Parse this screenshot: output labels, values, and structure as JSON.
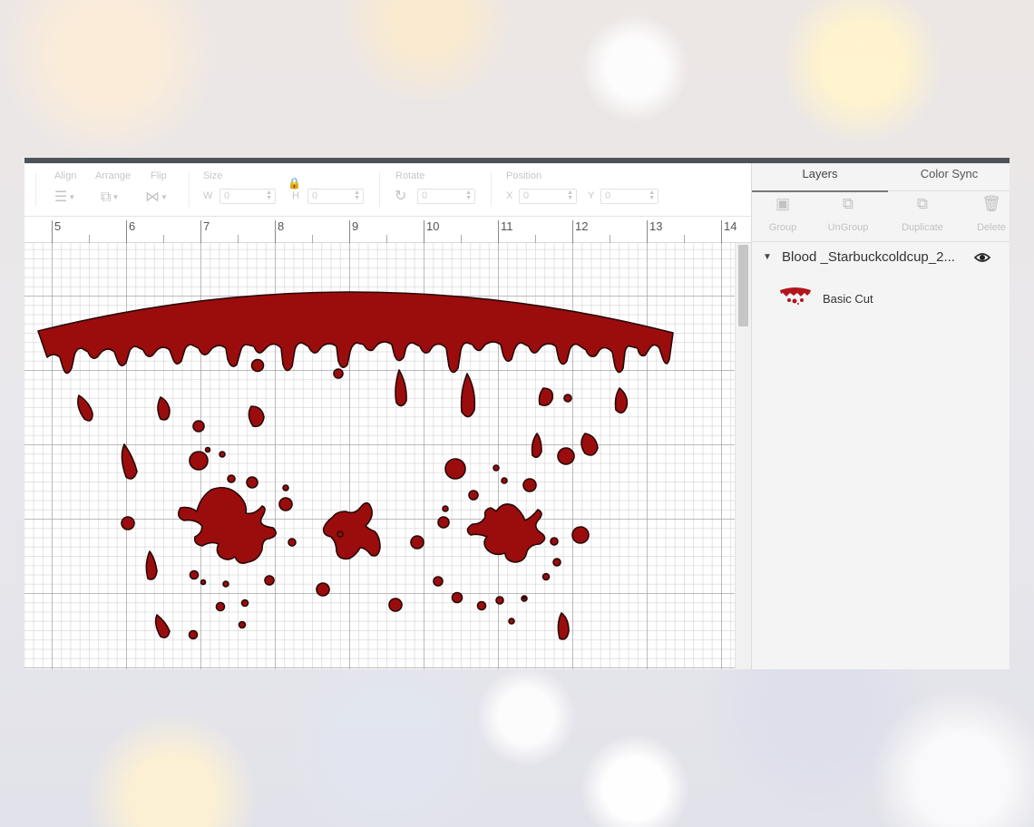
{
  "toolbar": {
    "align": {
      "label": "Align"
    },
    "arrange": {
      "label": "Arrange"
    },
    "flip": {
      "label": "Flip"
    },
    "size": {
      "label": "Size",
      "w_label": "W",
      "w_value": "0",
      "h_label": "H",
      "h_value": "0"
    },
    "rotate": {
      "label": "Rotate",
      "value": "0"
    },
    "position": {
      "label": "Position",
      "x_label": "X",
      "x_value": "0",
      "y_label": "Y",
      "y_value": "0"
    }
  },
  "ruler": {
    "ticks": [
      "5",
      "6",
      "7",
      "8",
      "9",
      "10",
      "11",
      "12",
      "13",
      "14"
    ]
  },
  "panel": {
    "tabs": [
      "Layers",
      "Color Sync"
    ],
    "actions": [
      {
        "label": "Group",
        "icon": "group-icon"
      },
      {
        "label": "UnGroup",
        "icon": "ungroup-icon"
      },
      {
        "label": "Duplicate",
        "icon": "duplicate-icon"
      },
      {
        "label": "Delete",
        "icon": "trash-icon"
      }
    ],
    "layer_group": {
      "name": "Blood _Starbuckcoldcup_2..."
    },
    "layer_item": {
      "label": "Basic Cut"
    }
  },
  "colors": {
    "blood": "#9b0d0d",
    "outline": "#2a0707",
    "header_bar": "#4d5358"
  },
  "canvas": {
    "content": "blood drip design",
    "visible": true
  }
}
